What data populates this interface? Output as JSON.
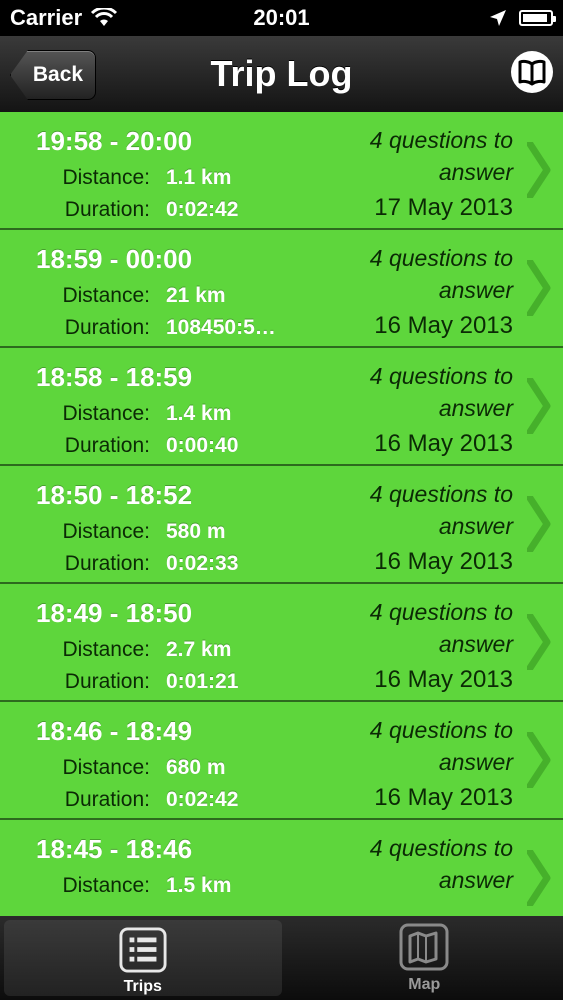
{
  "status_bar": {
    "carrier": "Carrier",
    "time": "20:01"
  },
  "nav_bar": {
    "back_label": "Back",
    "title": "Trip Log"
  },
  "labels": {
    "distance": "Distance:",
    "duration": "Duration:"
  },
  "trips": [
    {
      "time_range": "19:58 - 20:00",
      "distance": "1.1 km",
      "duration": "0:02:42",
      "questions": "4 questions to answer",
      "date": "17 May 2013"
    },
    {
      "time_range": "18:59 - 00:00",
      "distance": "21 km",
      "duration": "108450:5…",
      "questions": "4 questions to answer",
      "date": "16 May 2013"
    },
    {
      "time_range": "18:58 - 18:59",
      "distance": "1.4 km",
      "duration": "0:00:40",
      "questions": "4 questions to answer",
      "date": "16 May 2013"
    },
    {
      "time_range": "18:50 - 18:52",
      "distance": "580 m",
      "duration": "0:02:33",
      "questions": "4 questions to answer",
      "date": "16 May 2013"
    },
    {
      "time_range": "18:49 - 18:50",
      "distance": "2.7 km",
      "duration": "0:01:21",
      "questions": "4 questions to answer",
      "date": "16 May 2013"
    },
    {
      "time_range": "18:46 - 18:49",
      "distance": "680 m",
      "duration": "0:02:42",
      "questions": "4 questions to answer",
      "date": "16 May 2013"
    },
    {
      "time_range": "18:45 - 18:46",
      "distance": "1.5 km",
      "duration": "",
      "questions": "4 questions to answer",
      "date": ""
    }
  ],
  "tab_bar": {
    "tabs": [
      {
        "label": "Trips",
        "icon": "list-icon",
        "selected": true
      },
      {
        "label": "Map",
        "icon": "map-icon",
        "selected": false
      }
    ]
  },
  "colors": {
    "row_green": "#5ed63c",
    "row_border": "#2d6a1e"
  }
}
